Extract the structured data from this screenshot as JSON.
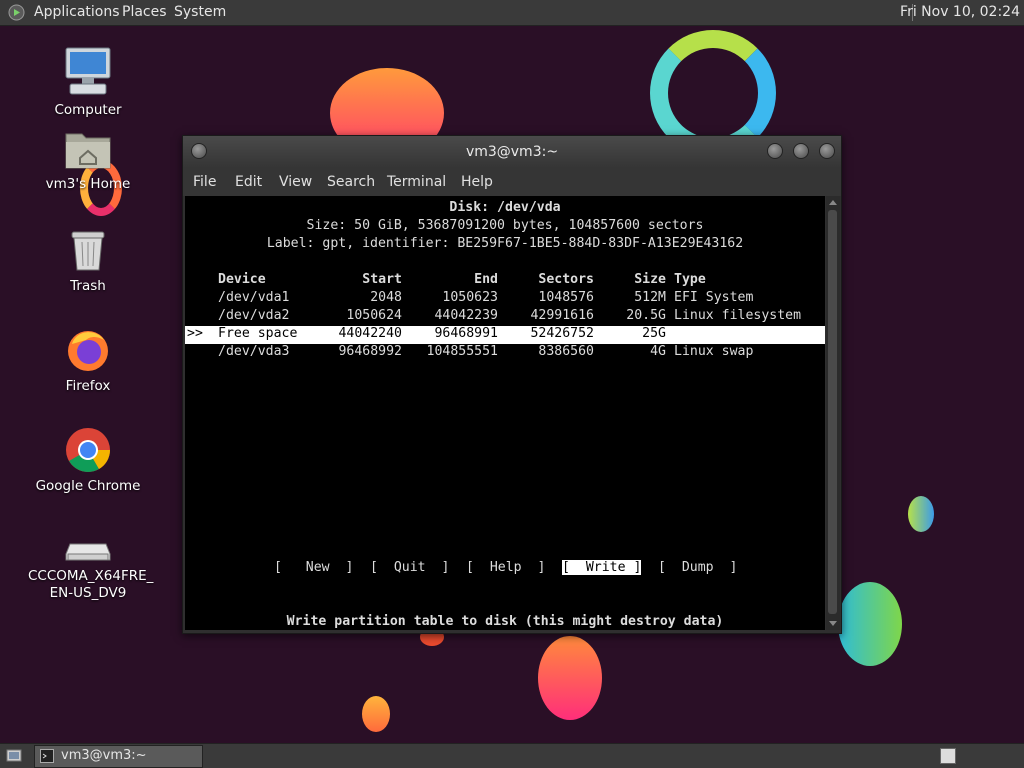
{
  "top_panel": {
    "menus": [
      "Applications",
      "Places",
      "System"
    ],
    "clock": "Fri Nov 10, 02:24"
  },
  "desktop": {
    "icons": [
      {
        "label": "Computer",
        "icon": "computer-icon"
      },
      {
        "label": "vm3's Home",
        "icon": "home-folder-icon"
      },
      {
        "label": "Trash",
        "icon": "trash-icon"
      },
      {
        "label": "Firefox",
        "icon": "firefox-icon"
      },
      {
        "label": "Google Chrome",
        "icon": "chrome-icon"
      },
      {
        "label": "CCCOMA_X64FRE_\nEN-US_DV9",
        "icon": "optical-drive-icon"
      }
    ]
  },
  "window": {
    "title": "vm3@vm3:~",
    "menu": [
      "File",
      "Edit",
      "View",
      "Search",
      "Terminal",
      "Help"
    ]
  },
  "cfdisk": {
    "disk_title": "Disk: /dev/vda",
    "size_line": "Size: 50 GiB, 53687091200 bytes, 104857600 sectors",
    "label_line": "Label: gpt, identifier: BE259F67-1BE5-884D-83DF-A13E29E43162",
    "headers": [
      "Device",
      "Start",
      "End",
      "Sectors",
      "Size",
      "Type"
    ],
    "rows": [
      {
        "marker": "",
        "device": "/dev/vda1",
        "start": "2048",
        "end": "1050623",
        "sectors": "1048576",
        "size": "512M",
        "type": "EFI System"
      },
      {
        "marker": "",
        "device": "/dev/vda2",
        "start": "1050624",
        "end": "44042239",
        "sectors": "42991616",
        "size": "20.5G",
        "type": "Linux filesystem"
      },
      {
        "marker": ">>",
        "device": "Free space",
        "start": "44042240",
        "end": "96468991",
        "sectors": "52426752",
        "size": "25G",
        "type": ""
      },
      {
        "marker": "",
        "device": "/dev/vda3",
        "start": "96468992",
        "end": "104855551",
        "sectors": "8386560",
        "size": "4G",
        "type": "Linux swap"
      }
    ],
    "actions": [
      "[   New  ]",
      "[  Quit  ]",
      "[  Help  ]",
      "[  Write ]",
      "[  Dump  ]"
    ],
    "active_action": "[  Write ]",
    "hint": "Write partition table to disk (this might destroy data)"
  },
  "taskbar": {
    "task_label": "vm3@vm3:~"
  },
  "colors": {
    "desktop_bg": "#2a0f26",
    "panel_bg": "#3a3a3a",
    "terminal_bg": "#000000",
    "selection_bg": "#ffffff"
  }
}
